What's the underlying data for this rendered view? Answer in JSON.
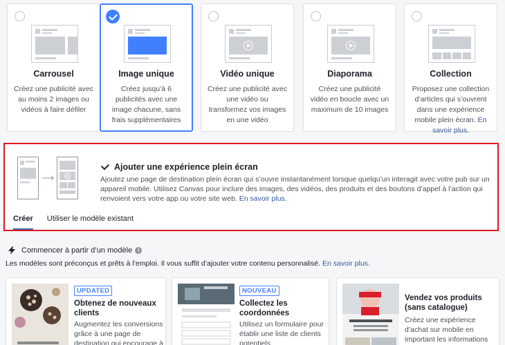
{
  "formats": [
    {
      "title": "Carrousel",
      "desc": "Créez une publicité avec au moins 2 images ou vidéos à faire défiler",
      "selected": false
    },
    {
      "title": "Image unique",
      "desc": "Créez jusqu’à 6 publicités avec une image chacune, sans frais supplémentaires",
      "selected": true
    },
    {
      "title": "Vidéo unique",
      "desc": "Créez une publicité avec une vidéo ou transformez vos images en une vidéo",
      "selected": false
    },
    {
      "title": "Diaporama",
      "desc": "Créez une publicité vidéo en boucle avec un maximum de 10 images",
      "selected": false
    },
    {
      "title": "Collection",
      "desc": "Proposez une collection d’articles qui s’ouvrent dans une expérience mobile plein écran.",
      "link": "En savoir plus.",
      "selected": false
    }
  ],
  "canvas": {
    "title": "Ajouter une expérience plein écran",
    "desc": "Ajoutez une page de destination plein écran qui s’ouvre instantanément lorsque quelqu’un interagit avec votre pub sur un appareil mobile. Utilisez Canvas pour inclure des images, des vidéos, des produits et des boutons d’appel à l’action qui renvoient vers votre app ou votre site web.",
    "link": "En savoir plus.",
    "tabs": [
      "Créer",
      "Utiliser le modèle existant"
    ]
  },
  "templates": {
    "heading": "Commencer à partir d’un modèle",
    "info_icon": "i",
    "sub": "Les modèles sont préconçus et prêts à l’emploi. Il vous suffit d’ajouter votre contenu personnalisé.",
    "sub_link": "En savoir plus.",
    "cards": [
      {
        "badge": "UPDATED",
        "title": "Obtenez de nouveaux clients",
        "desc": "Augmentez les conversions grâce à une page de destination qui encourage à"
      },
      {
        "badge": "NOUVEAU",
        "title": "Collectez les coordonnées",
        "desc": "Utilisez un formulaire pour établir une liste de clients potentiels."
      },
      {
        "badge": "",
        "title": "Vendez vos produits (sans catalogue)",
        "desc": "Créez une expérience d’achat sur mobile en important les informations de produits ou lieu"
      }
    ]
  },
  "colors": {
    "accent": "#4080ff",
    "link": "#365899",
    "highlight_border": "#e0141e"
  }
}
